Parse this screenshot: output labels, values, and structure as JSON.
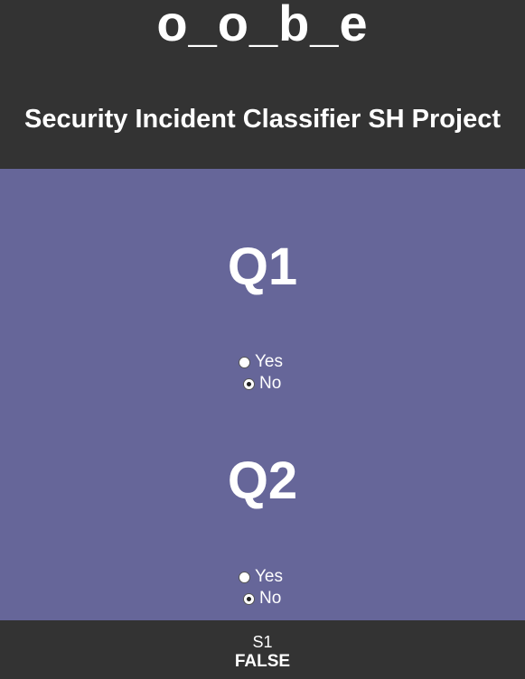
{
  "header": {
    "logo_text": "o_o_b_e",
    "title": "Security Incident Classifier SH Project"
  },
  "questions": [
    {
      "heading": "Q1",
      "options": [
        {
          "label": "Yes",
          "selected": false
        },
        {
          "label": "No",
          "selected": true
        }
      ]
    },
    {
      "heading": "Q2",
      "options": [
        {
          "label": "Yes",
          "selected": false
        },
        {
          "label": "No",
          "selected": true
        }
      ]
    }
  ],
  "footer": {
    "status_id": "S1",
    "status_value": "FALSE"
  }
}
